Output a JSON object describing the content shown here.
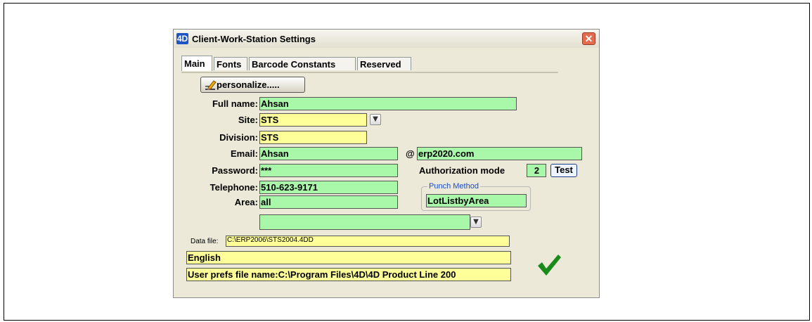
{
  "window": {
    "title": "Client-Work-Station Settings",
    "logo": "4D",
    "close_glyph": "✕"
  },
  "tabs": [
    "Main",
    "Fonts",
    "Barcode Constants",
    "Reserved"
  ],
  "personalize_button": "personalize.....",
  "fields": {
    "full_name_label": "Full name:",
    "full_name_value": "Ahsan",
    "site_label": "Site:",
    "site_value": "STS",
    "division_label": "Division:",
    "division_value": "STS",
    "email_label": "Email:",
    "email_value": "Ahsan",
    "at_symbol": "@",
    "email_domain": "erp2020.com",
    "password_label": "Password:",
    "password_value": "***",
    "auth_mode_label": "Authorization mode",
    "auth_mode_value": "2",
    "test_button": "Test",
    "telephone_label": "Telephone:",
    "telephone_value": "510-623-9171",
    "area_label": "Area:",
    "area_value": "all",
    "punch_method_title": "Punch Method",
    "punch_method_value": "LotListbyArea",
    "empty_dropdown_value": "",
    "data_file_label": "Data file:",
    "data_file_value": "C:\\ERP2006\\STS2004.4DD",
    "language_value": "English",
    "user_prefs_value": "User prefs file name:C:\\Program Files\\4D\\4D Product Line 200"
  },
  "colors": {
    "field_green": "#a9f7a9",
    "field_yellow": "#ffff99",
    "check_green": "#1a8a1a",
    "window_bg": "#ece9d8"
  },
  "icons": {
    "dropdown": "chevron-down-icon",
    "personalize": "pencil-icon",
    "confirm": "checkmark-icon"
  }
}
